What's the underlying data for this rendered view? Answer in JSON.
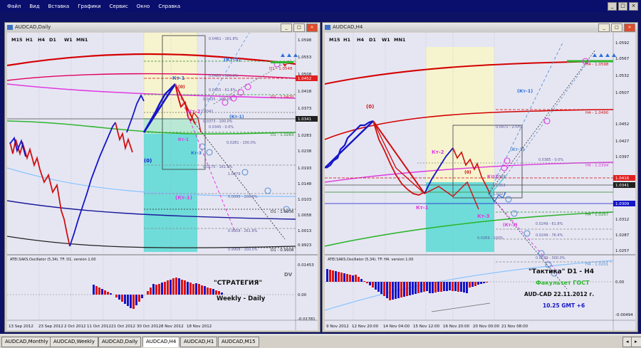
{
  "menu": {
    "items": [
      "Файл",
      "Вид",
      "Вставка",
      "Графики",
      "Сервис",
      "Окно",
      "Справка"
    ],
    "controls": [
      "_",
      "□",
      "×"
    ]
  },
  "left_chart": {
    "title": "AUDCAD,Daily",
    "timeframes": [
      "M15",
      "H1",
      "H4",
      "D1",
      "W1",
      "MN1"
    ],
    "price_scale": [
      "1.0598",
      "1.0553",
      "1.0508",
      "1.0463",
      "1.0418",
      "1.0373",
      "1.0328",
      "1.0283",
      "1.0238",
      "1.0193",
      "1.0148",
      "1.0103",
      "1.0058",
      "1.0013",
      "0.9968",
      "0.9923",
      "0.9878"
    ],
    "time_labels": [
      "13 Sep 2012",
      "23 Sep 2012",
      "2 Oct 2012",
      "11 Oct 2012",
      "21 Oct 2012",
      "30 Oct 2012",
      "8 Nov 2012",
      "18 Nov 2012"
    ],
    "tags": {
      "kt1_top": "Кт-1",
      "kt2": "Кт-2",
      "kt3_top": "(Кт-3)",
      "kt1_low": "(Кт-1)",
      "kt1_mid": "Кт-1",
      "kt1_paren": "(Кт-1)",
      "zero_top": "(0)",
      "zero_low": "(0)",
      "kt3": "Кт-3"
    },
    "levels": [
      "D1 - 1.0548",
      "D1 - 1.0420",
      "D1 - 1.0283",
      "D1 - 1.0036",
      "D1 - 0.9908"
    ],
    "fib_labels": [
      "0.0461 - 161.8%",
      "0.0481 - 100.0%",
      "0.0455 - 61.8%",
      "0.0435 - 100.0%",
      "0.0373 - 100.0%",
      "0.0345 - 0.0%",
      "0.0281 - 100.0%",
      "0.0175 - 161.8%",
      "0.0095 - 200.0%",
      "0.9958 - 261.8%",
      "0.9908 - 300.0%",
      "1.0341",
      "1.0379"
    ],
    "price_markers": [
      "1.0452",
      "1.0341"
    ],
    "oscillator_title": "ATEI.SAKS.Oscillator (5,34). TF: D1. version 1.00",
    "oscillator_scale": [
      "0.01453",
      "0.00",
      "-0.01781"
    ],
    "strategy_text": "\"СТРАТЕГИЯ\"",
    "strategy_sub": "Weekly - Daily",
    "dv_label": "DV"
  },
  "right_chart": {
    "title": "AUDCAD,H4",
    "timeframes": [
      "M15",
      "H1",
      "H4",
      "D1",
      "W1",
      "MN1"
    ],
    "price_scale": [
      "1.0592",
      "1.0567",
      "1.0532",
      "1.0507",
      "1.0482",
      "1.0452",
      "1.0427",
      "1.0397",
      "1.0367",
      "1.0337",
      "1.0312",
      "1.0287",
      "1.0257",
      "1.0227",
      "1.0202",
      "1.0177"
    ],
    "time_labels": [
      "9 Nov 2012",
      "12 Nov 20:00",
      "14 Nov 04:00",
      "15 Nov 12:00",
      "16 Nov 20:00",
      "20 Nov 00:00",
      "21 Nov 08:00"
    ],
    "tags": {
      "zero": "(0)",
      "kt1_top": "(Кт-1)",
      "kt2": "Кт-2",
      "kt1_pink": "Кт-1",
      "kt3": "Кт-3",
      "kt3_paren": "(Кт-3)",
      "kt2_small": "Кт-2",
      "zero_small": "(0)",
      "kt1_small": "(Кт-1)"
    },
    "levels": [
      "H4 - 1.0598",
      "H4 - 1.0490",
      "H4 - 1.0394",
      "H4 - 1.0267",
      "H4 - 1.0201"
    ],
    "fib_labels": [
      "0.0471 - 270%",
      "0.0385 - 0.0%",
      "1.0369",
      "1.0353",
      "1.0327",
      "0.0249 - 61.8%",
      "0.0249 - 76.4%",
      "0.0269 - 100%",
      "0.0239 - 300.0%"
    ],
    "price_markers": [
      "1.0416",
      "1.0341",
      "1.0309"
    ],
    "oscillator_title": "ATEI.SAKS.Oscillator (5,34). TF: H4. version 1.00",
    "oscillator_scale": [
      "0.00",
      "-0.00494"
    ],
    "tactic_text": "\"Тактика\"   D1 - H4",
    "faculty_text": "Факультет ГОСТ",
    "pair_date_text": "AUD-CAD  22.11.2012  г.",
    "time_text": "10.25   GMT +6"
  },
  "tabs": [
    "AUDCAD,Monthly",
    "AUDCAD,Weekly",
    "AUDCAD,Daily",
    "AUDCAD,H4",
    "AUDCAD,H1",
    "AUDCAD,M15"
  ],
  "active_tab": "AUDCAD,H4",
  "colors": {
    "background": "#0e1264",
    "chart_bg": "#e6e6f3",
    "bull": "#1515c8",
    "bear": "#e01010",
    "fib_zone": "#6fdcd9",
    "highlight_zone": "#f6f4cf"
  }
}
